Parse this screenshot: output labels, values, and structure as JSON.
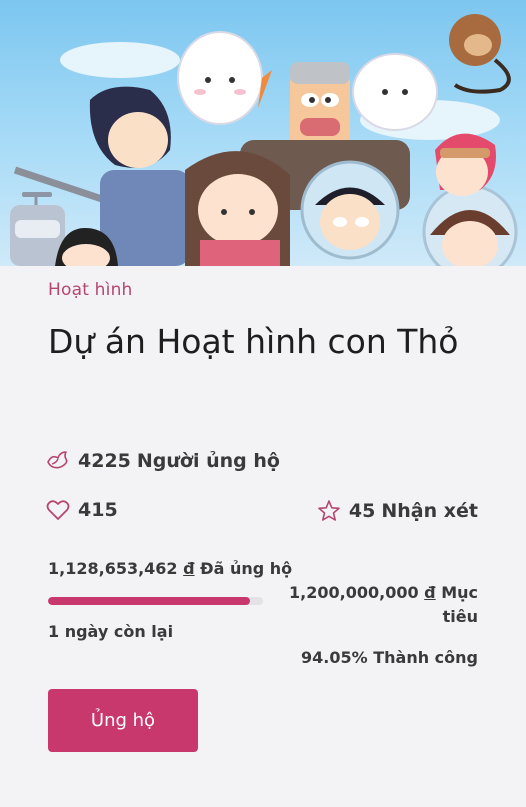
{
  "project": {
    "category": "Hoạt hình",
    "title": "Dự án Hoạt hình con Thỏ",
    "backers_count": "4225",
    "backers_label": "Người ủng hộ",
    "likes": "415",
    "reviews_count": "45",
    "reviews_label": "Nhận xét",
    "raised_amount": "1,128,653,462",
    "currency": "đ",
    "raised_label": "Đã ủng hộ",
    "goal_amount": "1,200,000,000",
    "goal_label": "Mục tiêu",
    "time_left": "1 ngày còn lại",
    "success_text": "94.05% Thành công",
    "progress_fraction": 0.9405,
    "support_button": "Ủng hộ"
  },
  "icons": {
    "backers": "dove-icon",
    "likes": "heart-icon",
    "reviews": "star-icon"
  },
  "colors": {
    "accent": "#c9386c",
    "category_text": "#b5476e",
    "background": "#f3f2f5"
  }
}
